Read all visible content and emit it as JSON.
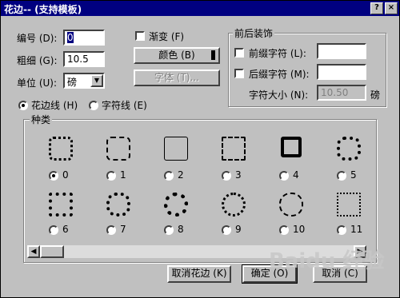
{
  "window": {
    "title": "花边-- (支持模板)",
    "help_btn": "?",
    "close_btn": "×"
  },
  "left": {
    "number_label": "编号 (D):",
    "number_value": "0",
    "thickness_label": "粗细 (G):",
    "thickness_value": "10.5",
    "unit_label": "单位 (U):",
    "unit_value": "磅"
  },
  "middle": {
    "gradient_label": "渐变 (F)",
    "color_button": "颜色 (B)",
    "font_button": "字体 (T)..."
  },
  "decoration": {
    "group_title": "前后装饰",
    "prefix_label": "前缀字符 (L):",
    "prefix_value": "",
    "suffix_label": "后缀字符 (M):",
    "suffix_value": "",
    "size_label": "字符大小 (N):",
    "size_value": "10.50",
    "size_unit": "磅"
  },
  "mode": {
    "border_line_label": "花边线 (H)",
    "char_line_label": "字符线 (E)"
  },
  "types": {
    "group_title": "种类",
    "items": [
      "0",
      "1",
      "2",
      "3",
      "4",
      "5",
      "6",
      "7",
      "8",
      "9",
      "10",
      "11"
    ],
    "selected": "0"
  },
  "buttons": {
    "cancel_border": "取消花边 (K)",
    "ok": "确定 (O)",
    "cancel": "取消 (C)"
  },
  "watermark": "Baidu 经验"
}
